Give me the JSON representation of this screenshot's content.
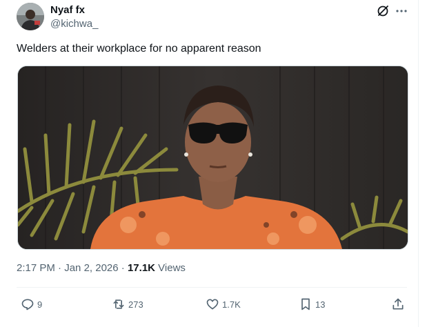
{
  "author": {
    "name": "Nyaf fx",
    "handle": "@kichwa_"
  },
  "tweet": {
    "text": "Welders at their workplace for no apparent reason"
  },
  "meta": {
    "time": "2:17 PM",
    "date": "Jan 2, 2026",
    "separator": "·",
    "views_count": "17.1K",
    "views_label": "Views"
  },
  "actions": {
    "replies": "9",
    "reposts": "273",
    "likes": "1.7K",
    "bookmarks": "13"
  },
  "icons": [
    "grok-icon",
    "more-icon",
    "reply-icon",
    "repost-icon",
    "like-icon",
    "bookmark-icon",
    "share-icon"
  ],
  "colors": {
    "text_primary": "#0f1419",
    "text_secondary": "#536471",
    "border": "#eff3f4"
  }
}
